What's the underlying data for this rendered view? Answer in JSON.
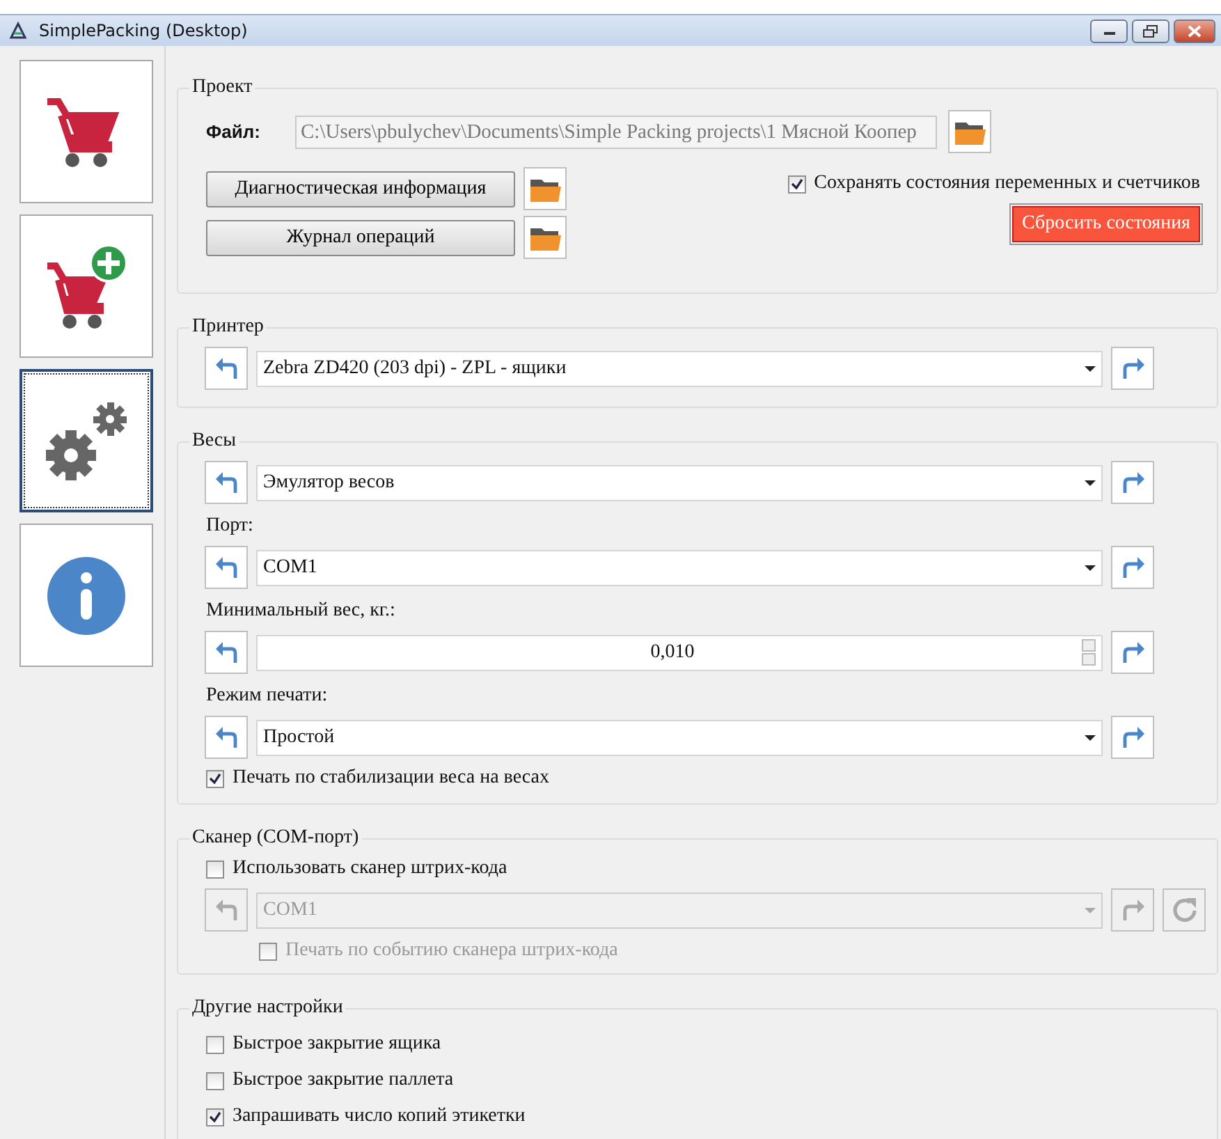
{
  "window": {
    "title": "SimplePacking (Desktop)"
  },
  "sidebar": {
    "items": [
      {
        "kind": "cart",
        "selected": false
      },
      {
        "kind": "cart-add",
        "selected": false
      },
      {
        "kind": "settings",
        "selected": true
      },
      {
        "kind": "info",
        "selected": false
      }
    ]
  },
  "project": {
    "title": "Проект",
    "file_label": "Файл:",
    "file_path": "C:\\Users\\pbulychev\\Documents\\Simple Packing projects\\1 Мясной Коопер",
    "buttons": [
      "Диагностическая информация",
      "Журнал операций"
    ],
    "save_state": {
      "label": "Сохранять состояния переменных и счетчиков",
      "checked": true
    },
    "reset_button": "Сбросить состояния"
  },
  "printer": {
    "title": "Принтер",
    "value": "Zebra ZD420 (203 dpi) - ZPL - ящики"
  },
  "scales": {
    "title": "Весы",
    "fields": [
      {
        "kind": "select",
        "value": "Эмулятор весов"
      },
      {
        "kind": "select",
        "label": "Порт:",
        "value": "COM1"
      },
      {
        "kind": "spin",
        "label": "Минимальный вес, кг.:",
        "value": "0,010"
      },
      {
        "kind": "select",
        "label": "Режим печати:",
        "value": "Простой"
      }
    ],
    "checkbox": {
      "label": "Печать по стабилизации веса на весах",
      "checked": true
    }
  },
  "scanner": {
    "title": "Сканер (COM-порт)",
    "use_checkbox": {
      "label": "Использовать сканер штрих-кода",
      "checked": false
    },
    "port": {
      "value": "COM1",
      "disabled": true
    },
    "event_checkbox": {
      "label": "Печать по событию сканера штрих-кода",
      "checked": false,
      "disabled": true
    }
  },
  "other": {
    "title": "Другие настройки",
    "checkboxes": [
      {
        "label": "Быстрое закрытие ящика",
        "checked": false
      },
      {
        "label": "Быстрое закрытие паллета",
        "checked": false
      },
      {
        "label": "Запрашивать число копий этикетки",
        "checked": true
      }
    ]
  }
}
